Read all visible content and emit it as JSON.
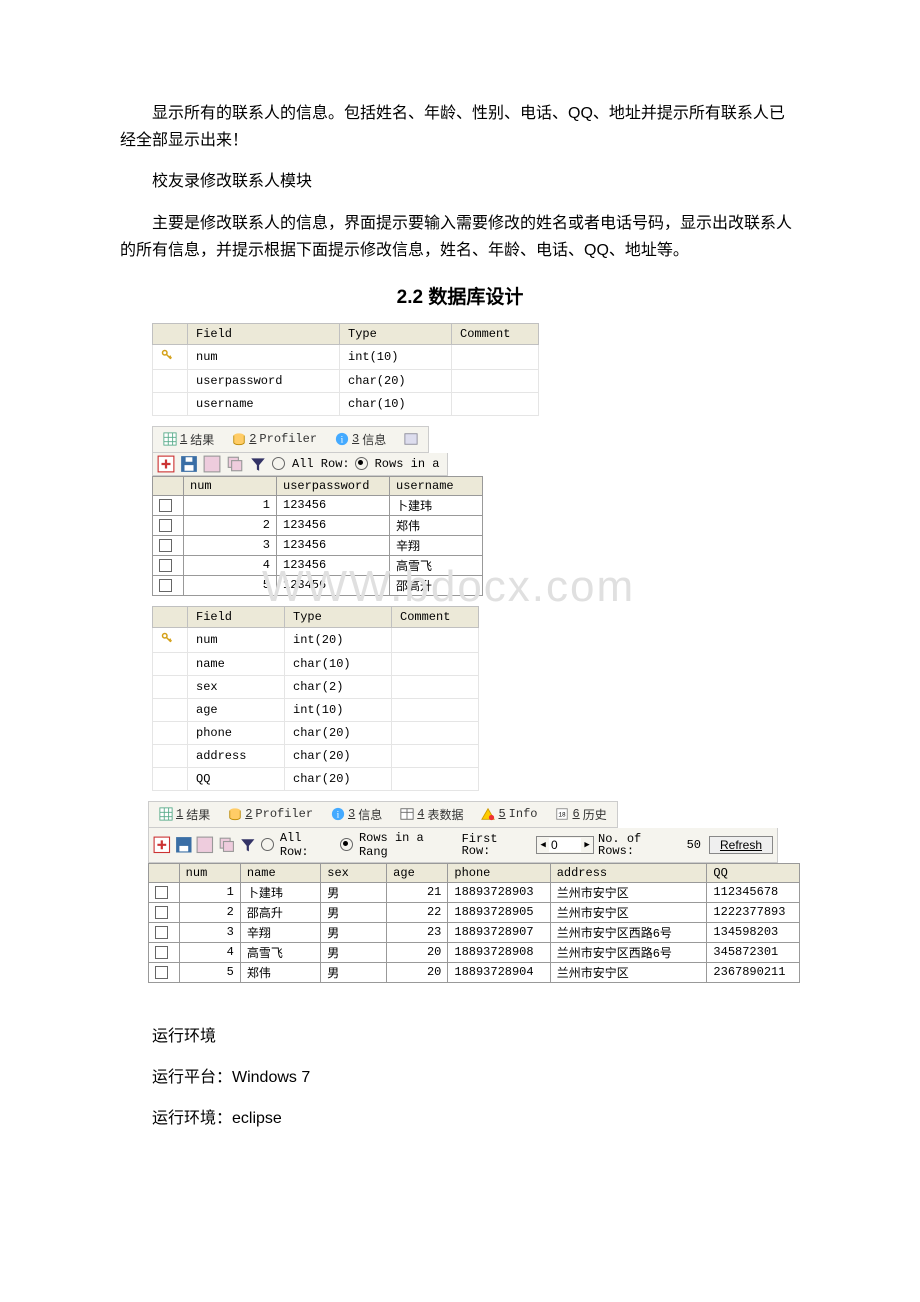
{
  "paragraphs": {
    "p1": "显示所有的联系人的信息。包括姓名、年龄、性别、电话、QQ、地址并提示所有联系人已经全部显示出来！",
    "p2": "校友录修改联系人模块",
    "p3": "主要是修改联系人的信息，界面提示要输入需要修改的姓名或者电话号码，显示出改联系人的所有信息，并提示根据下面提示修改信息，姓名、年龄、电话、QQ、地址等。"
  },
  "heading": "2.2 数据库设计",
  "watermark": "WWW.bdocx.com",
  "schema1": {
    "headers": [
      "Field",
      "Type",
      "Comment"
    ],
    "rows": [
      {
        "key": true,
        "field": "num",
        "type": "int(10)",
        "comment": ""
      },
      {
        "key": false,
        "field": "userpassword",
        "type": "char(20)",
        "comment": ""
      },
      {
        "key": false,
        "field": "username",
        "type": "char(10)",
        "comment": ""
      }
    ]
  },
  "tabs1": {
    "items": [
      {
        "icon": "grid-icon",
        "num": "1",
        "label": "结果",
        "active": true
      },
      {
        "icon": "db-icon",
        "num": "2",
        "label": "Profiler",
        "active": false
      },
      {
        "icon": "info-icon",
        "num": "3",
        "label": "信息",
        "active": false
      },
      {
        "icon": "panel-icon",
        "num": "",
        "label": "",
        "active": false
      }
    ]
  },
  "toolbar1": {
    "allRows": "All Row:",
    "rowsIn": "Rows in a"
  },
  "grid1": {
    "cols": [
      "num",
      "userpassword",
      "username"
    ],
    "rows": [
      {
        "num": "1",
        "userpassword": "123456",
        "username": "卜建玮"
      },
      {
        "num": "2",
        "userpassword": "123456",
        "username": "郑伟"
      },
      {
        "num": "3",
        "userpassword": "123456",
        "username": "辛翔"
      },
      {
        "num": "4",
        "userpassword": "123456",
        "username": "高雪飞"
      },
      {
        "num": "5",
        "userpassword": "123456",
        "username": "邵高升"
      }
    ]
  },
  "schema2": {
    "headers": [
      "Field",
      "Type",
      "Comment"
    ],
    "rows": [
      {
        "key": true,
        "field": "num",
        "type": "int(20)",
        "comment": ""
      },
      {
        "key": false,
        "field": "name",
        "type": "char(10)",
        "comment": ""
      },
      {
        "key": false,
        "field": "sex",
        "type": "char(2)",
        "comment": ""
      },
      {
        "key": false,
        "field": "age",
        "type": "int(10)",
        "comment": ""
      },
      {
        "key": false,
        "field": "phone",
        "type": "char(20)",
        "comment": ""
      },
      {
        "key": false,
        "field": "address",
        "type": "char(20)",
        "comment": ""
      },
      {
        "key": false,
        "field": "QQ",
        "type": "char(20)",
        "comment": ""
      }
    ]
  },
  "tabs2": {
    "items": [
      {
        "icon": "grid-icon",
        "num": "1",
        "label": "结果"
      },
      {
        "icon": "db-icon",
        "num": "2",
        "label": "Profiler"
      },
      {
        "icon": "info-icon",
        "num": "3",
        "label": "信息"
      },
      {
        "icon": "table-icon",
        "num": "4",
        "label": "表数据"
      },
      {
        "icon": "warn-icon",
        "num": "5",
        "label": "Info"
      },
      {
        "icon": "hist-icon",
        "num": "6",
        "label": "历史"
      }
    ]
  },
  "toolbar2": {
    "allRows": "All Row:",
    "rowsInRange": "Rows in a Rang",
    "firstRow": "First Row:",
    "firstRowVal": "0",
    "noOfRows": "No. of Rows:",
    "noOfRowsVal": "50",
    "refresh": "Refresh"
  },
  "grid2": {
    "cols": [
      "num",
      "name",
      "sex",
      "age",
      "phone",
      "address",
      "QQ"
    ],
    "rows": [
      {
        "num": "1",
        "name": "卜建玮",
        "sex": "男",
        "age": "21",
        "phone": "18893728903",
        "address": "兰州市安宁区",
        "QQ": "112345678"
      },
      {
        "num": "2",
        "name": "邵高升",
        "sex": "男",
        "age": "22",
        "phone": "18893728905",
        "address": "兰州市安宁区",
        "QQ": "1222377893"
      },
      {
        "num": "3",
        "name": "辛翔",
        "sex": "男",
        "age": "23",
        "phone": "18893728907",
        "address": "兰州市安宁区西路6号",
        "QQ": "134598203"
      },
      {
        "num": "4",
        "name": "高雪飞",
        "sex": "男",
        "age": "20",
        "phone": "18893728908",
        "address": "兰州市安宁区西路6号",
        "QQ": "345872301"
      },
      {
        "num": "5",
        "name": "郑伟",
        "sex": "男",
        "age": "20",
        "phone": "18893728904",
        "address": "兰州市安宁区",
        "QQ": "2367890211"
      }
    ]
  },
  "env": {
    "l1": "运行环境",
    "l2": "运行平台：Windows 7",
    "l3": "运行环境：eclipse"
  }
}
